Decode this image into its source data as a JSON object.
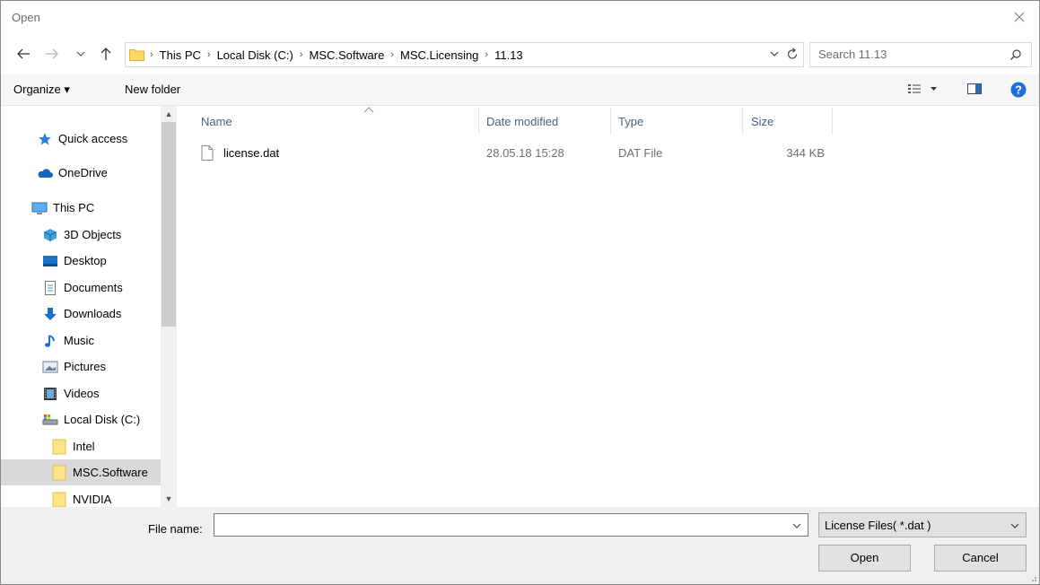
{
  "window": {
    "title": "Open"
  },
  "address": {
    "crumbs": [
      "This PC",
      "Local Disk (C:)",
      "MSC.Software",
      "MSC.Licensing",
      "11.13"
    ]
  },
  "search": {
    "placeholder": "Search 11.13"
  },
  "toolbar": {
    "organize_label": "Organize ▾",
    "new_folder_label": "New folder"
  },
  "navpane": {
    "items": [
      {
        "label": "Quick access",
        "icon": "star-icon"
      },
      {
        "label": "OneDrive",
        "icon": "cloud-icon"
      },
      {
        "label": "This PC",
        "icon": "computer-icon"
      },
      {
        "label": "3D Objects",
        "icon": "cube-icon"
      },
      {
        "label": "Desktop",
        "icon": "desktop-icon"
      },
      {
        "label": "Documents",
        "icon": "document-icon"
      },
      {
        "label": "Downloads",
        "icon": "download-icon"
      },
      {
        "label": "Music",
        "icon": "music-icon"
      },
      {
        "label": "Pictures",
        "icon": "pictures-icon"
      },
      {
        "label": "Videos",
        "icon": "video-icon"
      },
      {
        "label": "Local Disk (C:)",
        "icon": "disk-icon"
      },
      {
        "label": "Intel",
        "icon": "folder-icon"
      },
      {
        "label": "MSC.Software",
        "icon": "folder-icon",
        "selected": true
      },
      {
        "label": "NVIDIA",
        "icon": "folder-icon"
      }
    ]
  },
  "filelist": {
    "columns": {
      "name": "Name",
      "date": "Date modified",
      "type": "Type",
      "size": "Size"
    },
    "rows": [
      {
        "name": "license.dat",
        "date": "28.05.18 15:28",
        "type": "DAT File",
        "size": "344 KB"
      }
    ]
  },
  "bottom": {
    "filename_label": "File name:",
    "filename_value": "",
    "filter_value": "License Files( *.dat )",
    "open_label": "Open",
    "cancel_label": "Cancel"
  }
}
